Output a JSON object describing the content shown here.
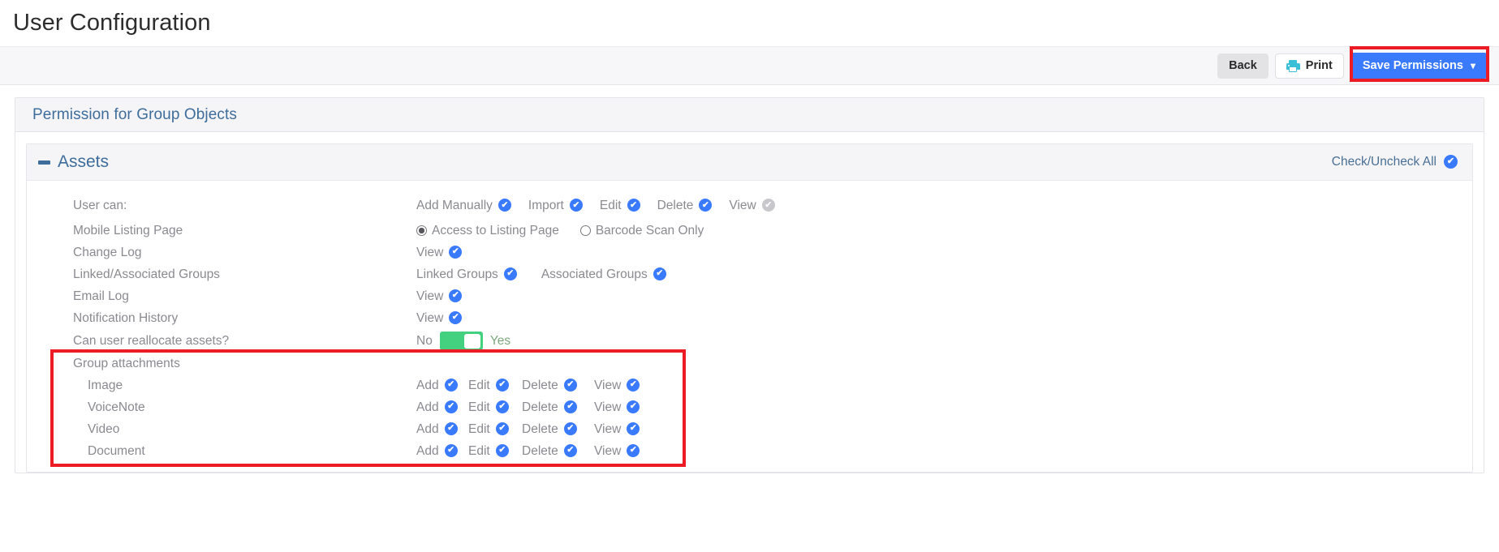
{
  "page": {
    "title": "User Configuration"
  },
  "toolbar": {
    "back_label": "Back",
    "print_label": "Print",
    "print_icon": "printer-icon",
    "save_label": "Save Permissions",
    "save_caret": "⌄",
    "accent_color": "#3a7afe",
    "print_icon_color": "#3bbfd6",
    "highlight_color": "#ed1c24"
  },
  "panel": {
    "title": "Permission for Group Objects"
  },
  "section": {
    "collapse_icon": "minus-icon",
    "title": "Assets",
    "check_all_label": "Check/Uncheck All",
    "check_all_icon": "check-circle-icon"
  },
  "check_icon": "✔",
  "rows": {
    "user_can": {
      "label": "User can:",
      "options": [
        {
          "label": "Add Manually",
          "checked": true,
          "state": "enabled"
        },
        {
          "label": "Import",
          "checked": true,
          "state": "enabled"
        },
        {
          "label": "Edit",
          "checked": true,
          "state": "enabled"
        },
        {
          "label": "Delete",
          "checked": true,
          "state": "enabled"
        },
        {
          "label": "View",
          "checked": true,
          "state": "disabled"
        }
      ]
    },
    "mobile_listing": {
      "label": "Mobile Listing Page",
      "radios": [
        {
          "label": "Access to Listing Page",
          "selected": true
        },
        {
          "label": "Barcode Scan Only",
          "selected": false
        }
      ]
    },
    "change_log": {
      "label": "Change Log",
      "options": [
        {
          "label": "View",
          "checked": true
        }
      ]
    },
    "linked_groups": {
      "label": "Linked/Associated Groups",
      "options": [
        {
          "label": "Linked Groups",
          "checked": true
        },
        {
          "label": "Associated Groups",
          "checked": true
        }
      ]
    },
    "email_log": {
      "label": "Email Log",
      "options": [
        {
          "label": "View",
          "checked": true
        }
      ]
    },
    "notification_history": {
      "label": "Notification History",
      "options": [
        {
          "label": "View",
          "checked": true
        }
      ]
    },
    "reallocate": {
      "label": "Can user reallocate assets?",
      "toggle": {
        "off_label": "No",
        "on_label": "Yes",
        "value": "Yes",
        "color": "#43d07f"
      }
    },
    "group_attachments": {
      "label": "Group attachments",
      "columns": [
        "Add",
        "Edit",
        "Delete",
        "View"
      ],
      "items": [
        {
          "label": "Image",
          "permissions": [
            true,
            true,
            true,
            true
          ]
        },
        {
          "label": "VoiceNote",
          "permissions": [
            true,
            true,
            true,
            true
          ]
        },
        {
          "label": "Video",
          "permissions": [
            true,
            true,
            true,
            true
          ]
        },
        {
          "label": "Document",
          "permissions": [
            true,
            true,
            true,
            true
          ]
        }
      ]
    }
  }
}
